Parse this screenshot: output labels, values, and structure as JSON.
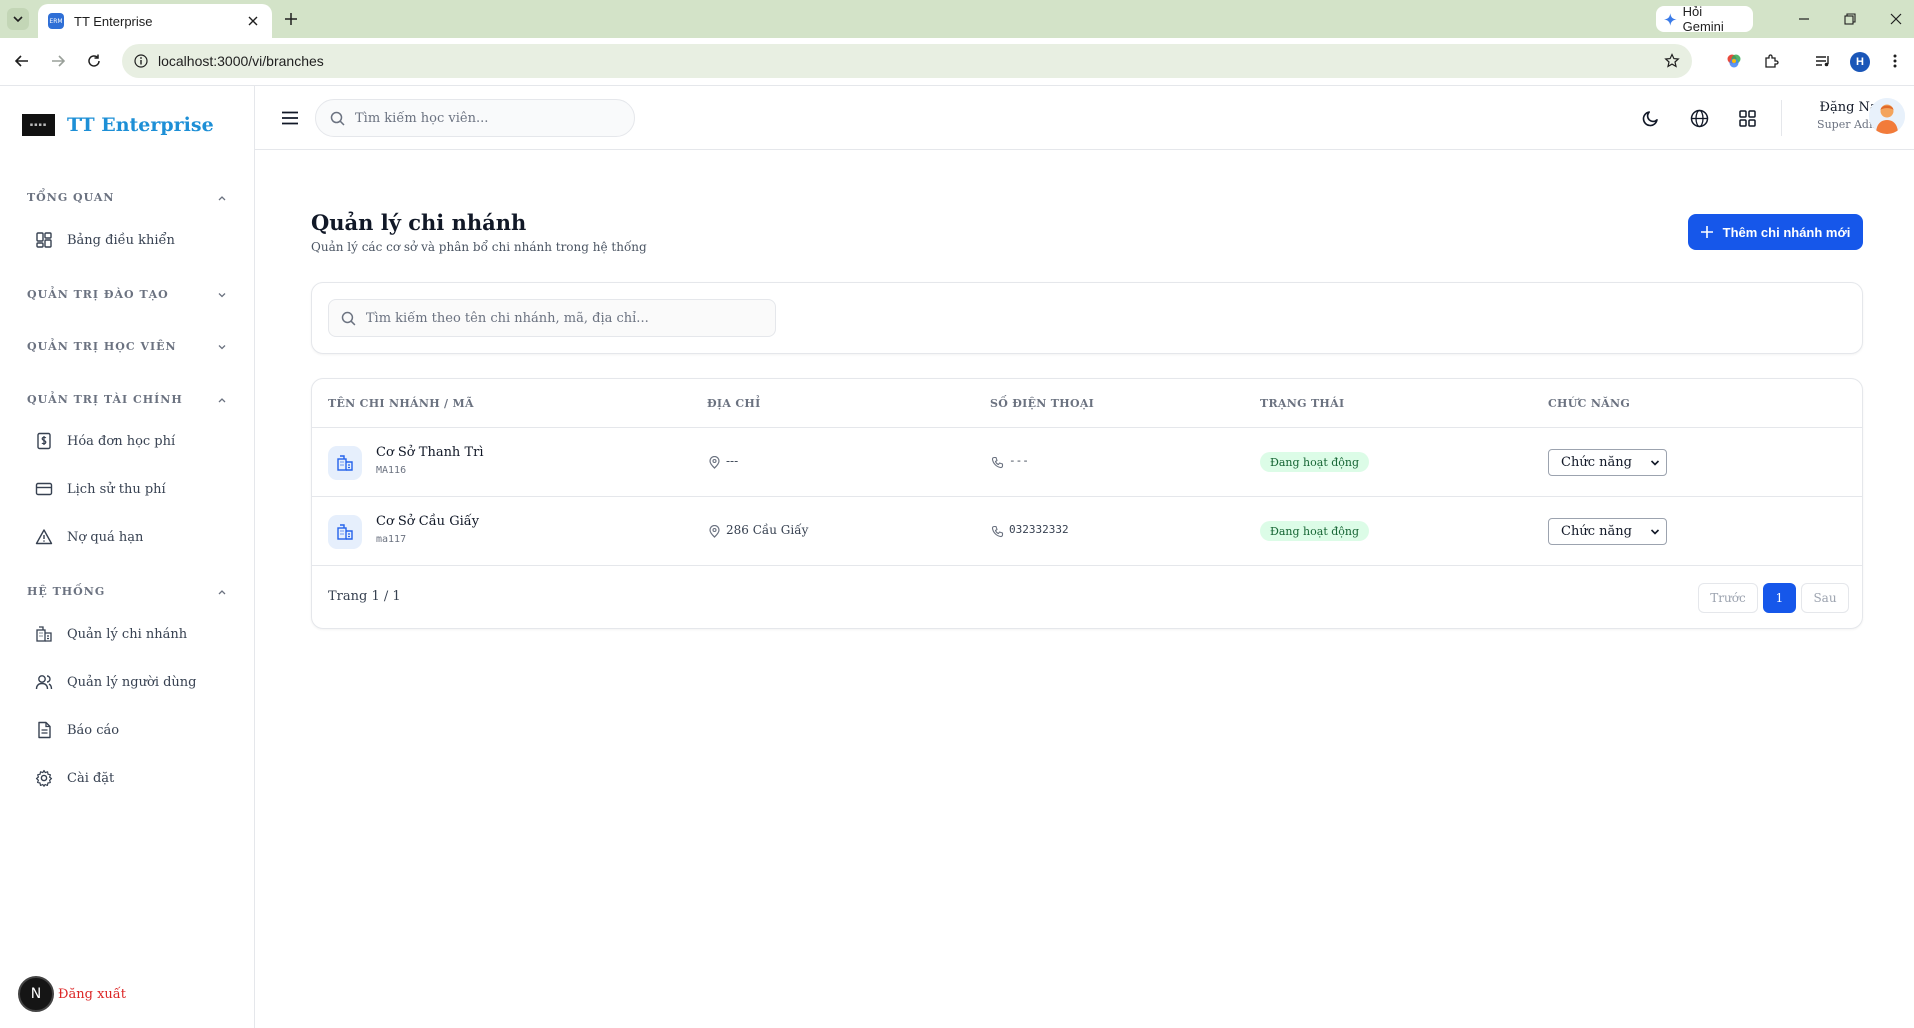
{
  "browser": {
    "tab_title": "TT Enterprise",
    "favicon_text": "ERM",
    "url": "localhost:3000/vi/branches",
    "gemini_label": "Hỏi Gemini",
    "profile_initial": "H"
  },
  "sidebar": {
    "brand_name": "TT Enterprise",
    "sections": {
      "overview": "TỔNG QUAN",
      "training": "QUẢN TRỊ ĐÀO TẠO",
      "students": "QUẢN TRỊ HỌC VIÊN",
      "finance": "QUẢN TRỊ TÀI CHÍNH",
      "system": "HỆ THỐNG"
    },
    "items": {
      "dashboard": "Bảng điều khiển",
      "invoices": "Hóa đơn học phí",
      "payment_history": "Lịch sử thu phí",
      "overdue": "Nợ quá hạn",
      "branches": "Quản lý chi nhánh",
      "users": "Quản lý người dùng",
      "reports": "Báo cáo",
      "settings": "Cài đặt"
    },
    "logout_initial": "N",
    "logout_label": "Đăng xuất"
  },
  "header": {
    "search_placeholder": "Tìm kiếm học viên...",
    "user_name": "Đặng Nam",
    "user_role": "Super Admin"
  },
  "main": {
    "title": "Quản lý chi nhánh",
    "subtitle": "Quản lý các cơ sở và phân bổ chi nhánh trong hệ thống",
    "add_button": "Thêm chi nhánh mới",
    "search_placeholder": "Tìm kiếm theo tên chi nhánh, mã, địa chỉ...",
    "columns": {
      "name": "TÊN CHI NHÁNH / MÃ",
      "address": "ĐỊA CHỈ",
      "phone": "SỐ ĐIỆN THOẠI",
      "status": "TRẠNG THÁI",
      "actions": "CHỨC NĂNG"
    },
    "rows": [
      {
        "name": "Cơ Sở Thanh Trì",
        "code": "MA116",
        "address": "---",
        "phone": "---",
        "status": "Đang hoạt động",
        "action": "Chức năng"
      },
      {
        "name": "Cơ Sở Cầu Giấy",
        "code": "ma117",
        "address": "286 Cầu Giấy",
        "phone": "032332332",
        "status": "Đang hoạt động",
        "action": "Chức năng"
      }
    ],
    "pagination": {
      "summary": "Trang 1 / 1",
      "prev": "Trước",
      "current": "1",
      "next": "Sau"
    }
  },
  "colors": {
    "primary": "#1657ea",
    "brand_text": "#1d8fd6",
    "active_badge_bg": "#dcfce7",
    "active_badge_text": "#166534",
    "logout_text": "#dc2626"
  }
}
